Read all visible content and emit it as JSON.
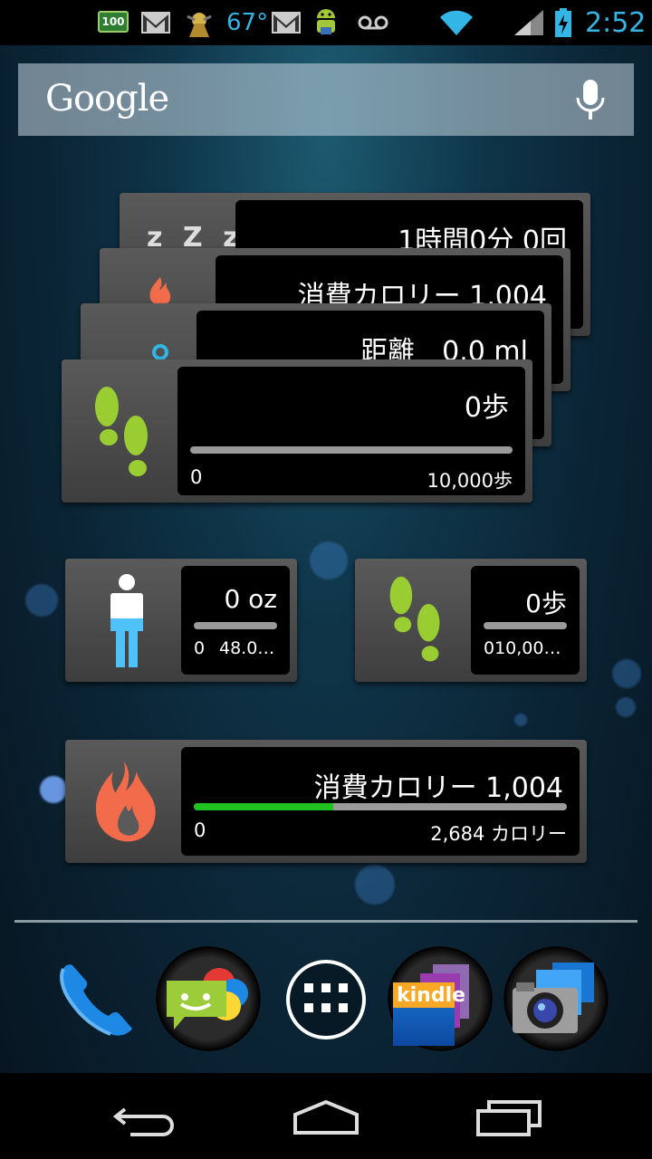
{
  "status_bar": {
    "battery_badge": "100",
    "temperature": "67°",
    "time": "2:52",
    "icons": [
      "battery-100-icon",
      "gmail-icon",
      "dragon-icon",
      "gmail-icon",
      "android-icon",
      "voicemail-icon",
      "wifi-icon",
      "signal-icon",
      "battery-charging-icon"
    ]
  },
  "search": {
    "logo_text": "Google",
    "mic_icon": "microphone-icon"
  },
  "stack_widget": {
    "sleep": {
      "text": "1時間0分 0回",
      "icon": "sleep-zzz-icon"
    },
    "calories": {
      "text": "消費カロリー 1,004",
      "icon": "flame-icon"
    },
    "distance": {
      "text": "距離　0.0 ml",
      "icon": "distance-icon"
    },
    "steps": {
      "value": "0歩",
      "min": "0",
      "max": "10,000歩",
      "progress": 0,
      "icon": "footprints-icon"
    }
  },
  "weight_widget": {
    "value": "0 oz",
    "min": "0",
    "max": "48.0…",
    "progress": 0,
    "icon": "person-icon"
  },
  "steps_widget": {
    "value": "0歩",
    "min": "",
    "max": "010,00…",
    "progress": 0,
    "icon": "footprints-icon"
  },
  "calorie_widget": {
    "value": "消費カロリー 1,004",
    "min": "0",
    "max": "2,684 カロリー",
    "progress": 0.374,
    "icon": "flame-icon"
  },
  "dock": {
    "items": [
      {
        "name": "phone",
        "icon": "phone-icon"
      },
      {
        "name": "messaging",
        "icon": "messaging-icon"
      },
      {
        "name": "apps",
        "icon": "app-drawer-icon"
      },
      {
        "name": "kindle",
        "label": "kindle",
        "icon": "kindle-icon"
      },
      {
        "name": "camera",
        "icon": "camera-icon"
      }
    ]
  },
  "nav": {
    "icons": [
      "back-icon",
      "home-icon",
      "recent-apps-icon"
    ]
  },
  "colors": {
    "accent": "#33b5e5",
    "progress_green": "#1fc21f",
    "footprint_green": "#9acd32",
    "flame": "#f26b4a",
    "person_blue": "#4fc3f7"
  }
}
